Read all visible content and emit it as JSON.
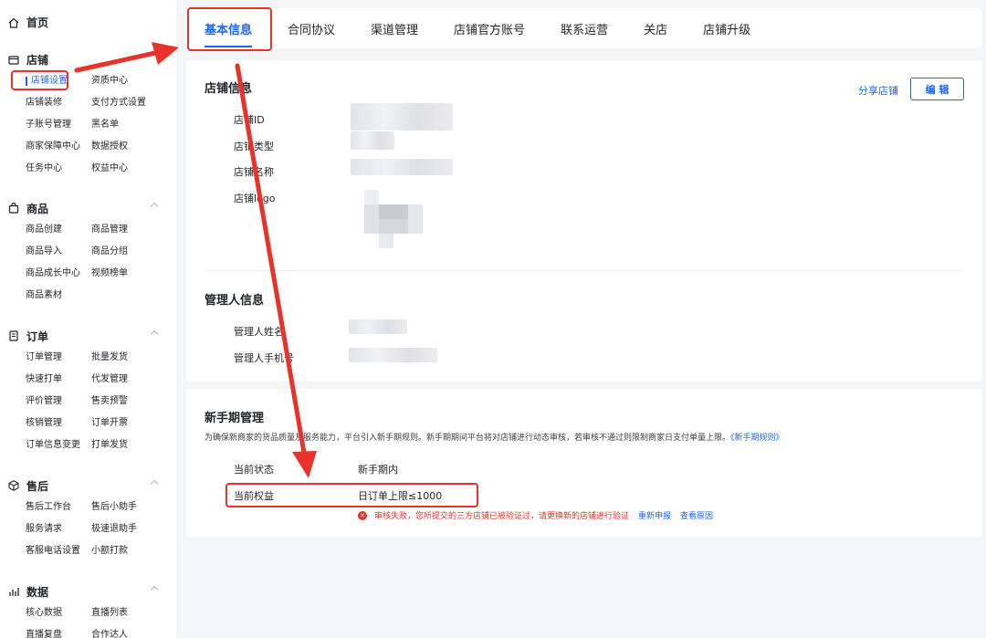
{
  "sidebar": {
    "home": "首页",
    "groups": [
      {
        "title": "店铺",
        "items": [
          "店铺设置",
          "资质中心",
          "店铺装修",
          "支付方式设置",
          "子账号管理",
          "黑名单",
          "商家保障中心",
          "数据授权",
          "任务中心",
          "权益中心"
        ]
      },
      {
        "title": "商品",
        "items": [
          "商品创建",
          "商品管理",
          "商品导入",
          "商品分组",
          "商品成长中心",
          "视频榜单",
          "商品素材"
        ]
      },
      {
        "title": "订单",
        "items": [
          "订单管理",
          "批量发货",
          "快速打单",
          "代发管理",
          "评价管理",
          "售卖预警",
          "核销管理",
          "订单开票",
          "订单信息变更",
          "打单发货"
        ]
      },
      {
        "title": "售后",
        "items": [
          "售后工作台",
          "售后小助手",
          "服务请求",
          "极速退助手",
          "客服电话设置",
          "小额打款"
        ]
      },
      {
        "title": "数据",
        "items": [
          "核心数据",
          "直播列表",
          "直播复盘",
          "合作达人"
        ]
      }
    ]
  },
  "tabs": [
    "基本信息",
    "合同协议",
    "渠道管理",
    "店铺官方账号",
    "联系运营",
    "关店",
    "店铺升级"
  ],
  "store_info": {
    "title": "店铺信息",
    "share_label": "分享店铺",
    "edit_label": "编 辑",
    "fields": [
      "店铺ID",
      "店铺类型",
      "店铺名称",
      "店铺logo"
    ]
  },
  "manager_info": {
    "title": "管理人信息",
    "fields": [
      "管理人姓名",
      "管理人手机号"
    ]
  },
  "newbie": {
    "title": "新手期管理",
    "desc": "为确保新商家的货品质量及服务能力，平台引入新手期规则。新手期期间平台将对店铺进行动态审核，若审核不通过则限制商家日支付单量上限。",
    "rule_link": "《新手期规则》",
    "status_label": "当前状态",
    "status_value": "新手期内",
    "benefit_label": "当前权益",
    "benefit_value": "日订单上限≤1000",
    "error_text": "审核失败，您所提交的三方店铺已被验证过，请更换新的店铺进行验证",
    "reapply_label": "重新申报",
    "view_reason_label": "查看原因"
  },
  "colors": {
    "accent": "#1966ff",
    "error": "#e8332a",
    "annotation": "#e8332a"
  }
}
